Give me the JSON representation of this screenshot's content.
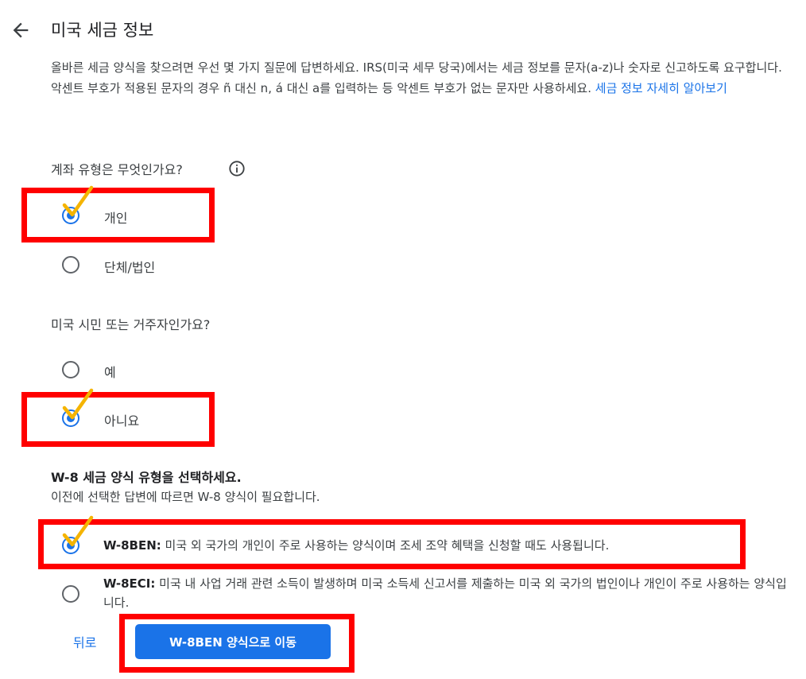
{
  "header": {
    "back_icon": "arrow-back-icon",
    "title": "미국 세금 정보"
  },
  "intro": {
    "text": "올바른 세금 양식을 찾으려면 우선 몇 가지 질문에 답변하세요. IRS(미국 세무 당국)에서는 세금 정보를 문자(a-z)나 숫자로 신고하도록 요구합니다. 악센트 부호가 적용된 문자의 경우 ñ 대신 n, á 대신 a를 입력하는 등 악센트 부호가 없는 문자만 사용하세요. ",
    "link": "세금 정보 자세히 알아보기"
  },
  "account_type": {
    "question": "계좌 유형은 무엇인가요?",
    "info_icon": "info-icon",
    "options": [
      {
        "label": "개인",
        "selected": true
      },
      {
        "label": "단체/법인",
        "selected": false
      }
    ]
  },
  "us_person": {
    "question": "미국 시민 또는 거주자인가요?",
    "options": [
      {
        "label": "예",
        "selected": false
      },
      {
        "label": "아니요",
        "selected": true
      }
    ]
  },
  "w8_section": {
    "title": "W-8 세금 양식 유형을 선택하세요.",
    "subtitle": "이전에 선택한 답변에 따르면 W-8 양식이 필요합니다.",
    "options": [
      {
        "name": "W-8BEN:",
        "desc": " 미국 외 국가의 개인이 주로 사용하는 양식이며 조세 조약 혜택을 신청할 때도 사용됩니다.",
        "selected": true
      },
      {
        "name": "W-8ECI:",
        "desc": " 미국 내 사업 거래 관련 소득이 발생하며 미국 소득세 신고서를 제출하는 미국 외 국가의 법인이나 개인이 주로 사용하는 양식입니다.",
        "selected": false
      }
    ]
  },
  "footer": {
    "back_label": "뒤로",
    "primary_label": "W-8BEN 양식으로 이동"
  },
  "annotations": {
    "highlight_color": "#ff0000",
    "checkmark_color": "#f5b400"
  },
  "colors": {
    "accent": "#1a73e8",
    "text": "#3c4043"
  }
}
